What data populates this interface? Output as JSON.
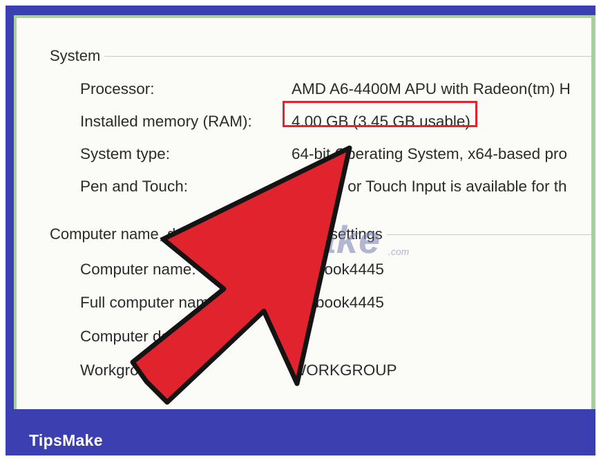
{
  "system": {
    "header": "System",
    "rows": [
      {
        "label": "Processor:",
        "value": "AMD A6-4400M APU with Radeon(tm) H"
      },
      {
        "label": "Installed memory (RAM):",
        "value": "4.00 GB (3.45 GB usable)"
      },
      {
        "label": "System type:",
        "value": "64-bit Operating System, x64-based pro"
      },
      {
        "label": "Pen and Touch:",
        "value": "No Pen or Touch Input is available for th"
      }
    ]
  },
  "computer": {
    "header": "Computer name, domain, and workgroup settings",
    "rows": [
      {
        "label": "Computer name:",
        "value": "Probook4445"
      },
      {
        "label": "Full computer name:",
        "value": "Probook4445"
      },
      {
        "label": "Computer description:",
        "value": ""
      },
      {
        "label": "Workgroup:",
        "value": "WORKGROUP"
      }
    ]
  },
  "watermark": {
    "text": "TipsMake",
    "suffix": ".com"
  },
  "footer": {
    "brand": "TipsMake"
  },
  "colors": {
    "frame": "#3b3fb0",
    "panel_border": "#a8cfa0",
    "highlight": "#e0232c",
    "arrow": "#e0232c"
  }
}
